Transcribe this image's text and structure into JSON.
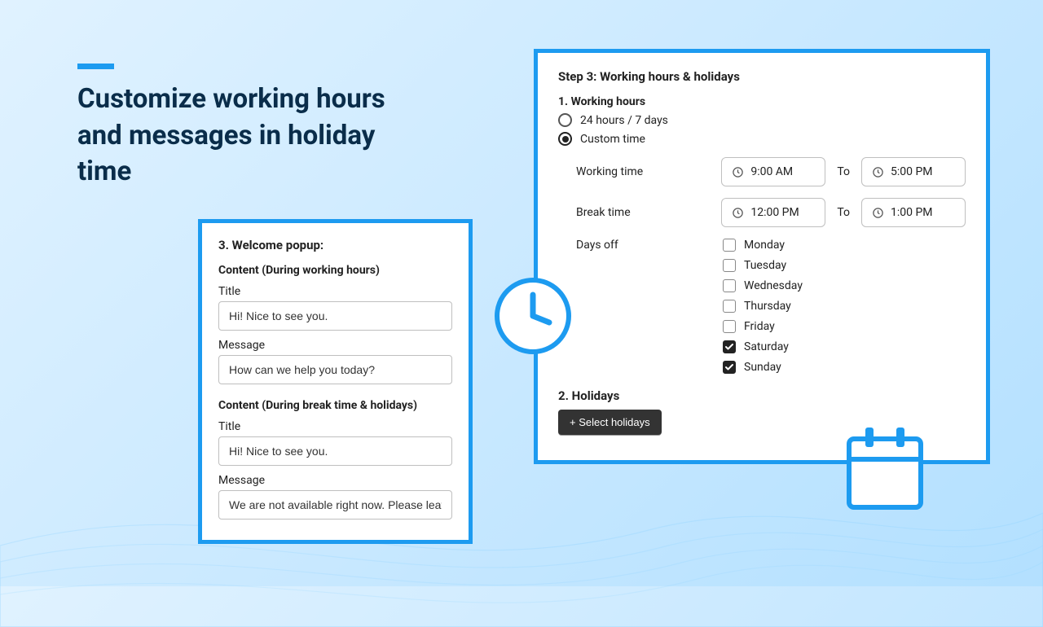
{
  "headline": "Customize working hours and messages in holiday time",
  "left_card": {
    "heading": "3. Welcome popup:",
    "working": {
      "group_label": "Content (During working hours)",
      "title_label": "Title",
      "title_value": "Hi! Nice to see you.",
      "message_label": "Message",
      "message_value": "How can we help you today?"
    },
    "break": {
      "group_label": "Content (During break time & holidays)",
      "title_label": "Title",
      "title_value": "Hi! Nice to see you.",
      "message_label": "Message",
      "message_value": "We are not available right now. Please leave a"
    }
  },
  "right_card": {
    "step_heading": "Step 3: Working hours & holidays",
    "working_hours_heading": "1. Working hours",
    "radio_24_7": "24 hours / 7 days",
    "radio_custom": "Custom time",
    "working_time_label": "Working time",
    "working_time_start": "9:00 AM",
    "working_time_end": "5:00 PM",
    "break_time_label": "Break time",
    "break_time_start": "12:00 PM",
    "break_time_end": "1:00 PM",
    "to_label": "To",
    "days_off_label": "Days off",
    "days": [
      {
        "label": "Monday",
        "checked": false
      },
      {
        "label": "Tuesday",
        "checked": false
      },
      {
        "label": "Wednesday",
        "checked": false
      },
      {
        "label": "Thursday",
        "checked": false
      },
      {
        "label": "Friday",
        "checked": false
      },
      {
        "label": "Saturday",
        "checked": true
      },
      {
        "label": "Sunday",
        "checked": true
      }
    ],
    "holidays_heading": "2. Holidays",
    "select_holidays_label": "+ Select holidays"
  }
}
